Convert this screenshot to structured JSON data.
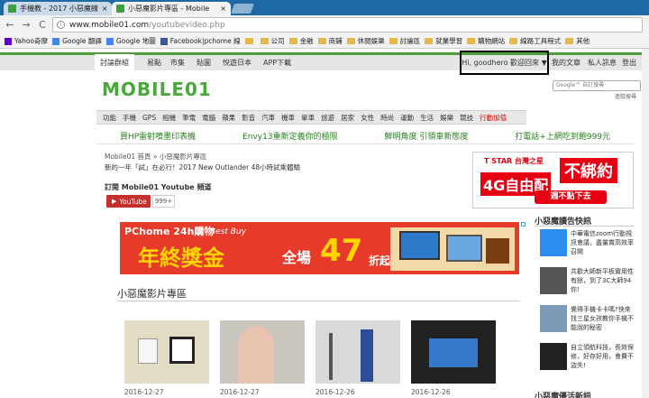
{
  "browser": {
    "tabs": [
      {
        "title": "手機教 - 2017 小惡魔線",
        "close": "×"
      },
      {
        "title": "小惡魔影片專區 - Mobile",
        "close": "×"
      }
    ],
    "back": "←",
    "forward": "→",
    "reload": "C",
    "url_host": "www.mobile01.com",
    "url_path": "/youtubevideo.php"
  },
  "bookmarks": [
    {
      "label": "Yahoo奇摩",
      "icon": "yahoo-icon"
    },
    {
      "label": "Google 翻譯",
      "icon": "google-icon"
    },
    {
      "label": "Google 地圖",
      "icon": "google-icon"
    },
    {
      "label": "Facebook|pchome 線",
      "icon": "facebook-icon"
    },
    {
      "label": "",
      "icon": "folder-icon"
    },
    {
      "label": "公司",
      "icon": "folder-icon"
    },
    {
      "label": "金融",
      "icon": "folder-icon"
    },
    {
      "label": "商鋪",
      "icon": "folder-icon"
    },
    {
      "label": "休閒娛樂",
      "icon": "folder-icon"
    },
    {
      "label": "討論區",
      "icon": "folder-icon"
    },
    {
      "label": "就業學習",
      "icon": "folder-icon"
    },
    {
      "label": "購物網站",
      "icon": "folder-icon"
    },
    {
      "label": "線路工具程式",
      "icon": "folder-icon"
    },
    {
      "label": "其他",
      "icon": "folder-icon"
    }
  ],
  "sitenav": {
    "items": [
      "討論群組",
      "易點",
      "市集",
      "貼圖",
      "悅遊日本",
      "APP下載"
    ],
    "user": "Hi, goodhero 歡迎回來 ▼",
    "right": [
      "我的文章",
      "私人訊息",
      "登出"
    ]
  },
  "logo": "MOBILE01",
  "search": {
    "placeholder": "Google™ 自訂搜尋",
    "advanced": "進階搜尋"
  },
  "categories": [
    "功能",
    "手機",
    "GPS",
    "相機",
    "筆電",
    "電腦",
    "蘋果",
    "影音",
    "汽車",
    "機車",
    "單車",
    "旅遊",
    "居家",
    "女性",
    "時尚",
    "運動",
    "生活",
    "娛樂",
    "競技",
    "行動加值"
  ],
  "promos": [
    "買HP雷射噴墨印表機",
    "Envy13重新定義你的極限",
    "鮮明角度 引領車新態度",
    "打電話+上網吃到飽999元"
  ],
  "breadcrumb": "Mobile01 首頁 » 小惡魔影片專區",
  "news": "新的一年「試」在必行！2017 New Outlander 48小時試乘體驗",
  "youtube": {
    "label": "訂閱 Mobile01 Youtube 頻道",
    "button": "YouTube",
    "count": "999+"
  },
  "banner": {
    "brand": "PChome 24h購物",
    "slogan": "Best Buy",
    "headline": "年終獎金",
    "sub": "全場",
    "number": "47",
    "unit": "折起"
  },
  "section_title": "小惡魔影片專區",
  "videos": [
    {
      "date": "2016-12-27"
    },
    {
      "date": "2016-12-27"
    },
    {
      "date": "2016-12-26"
    },
    {
      "date": "2016-12-26"
    }
  ],
  "side_ad": {
    "brand": "T STAR 台灣之星",
    "main": "4G自由配",
    "highlight": "不綁約",
    "button": "週不點下去"
  },
  "sidebar": {
    "title": "小惡魔讀告快訊",
    "items": [
      "中華電信zoom行動視訊會議，盡量賞高效率召開",
      "共歡大師新平板實用性有餘，到了3C大師94你!",
      "覺得手機卡卡嗎?快來找三星女孩教你手機不能說的秘密",
      "自立領航科技，長效保修，好存好用，會費不盜失!"
    ],
    "title2": "小惡魔優活新訊"
  }
}
